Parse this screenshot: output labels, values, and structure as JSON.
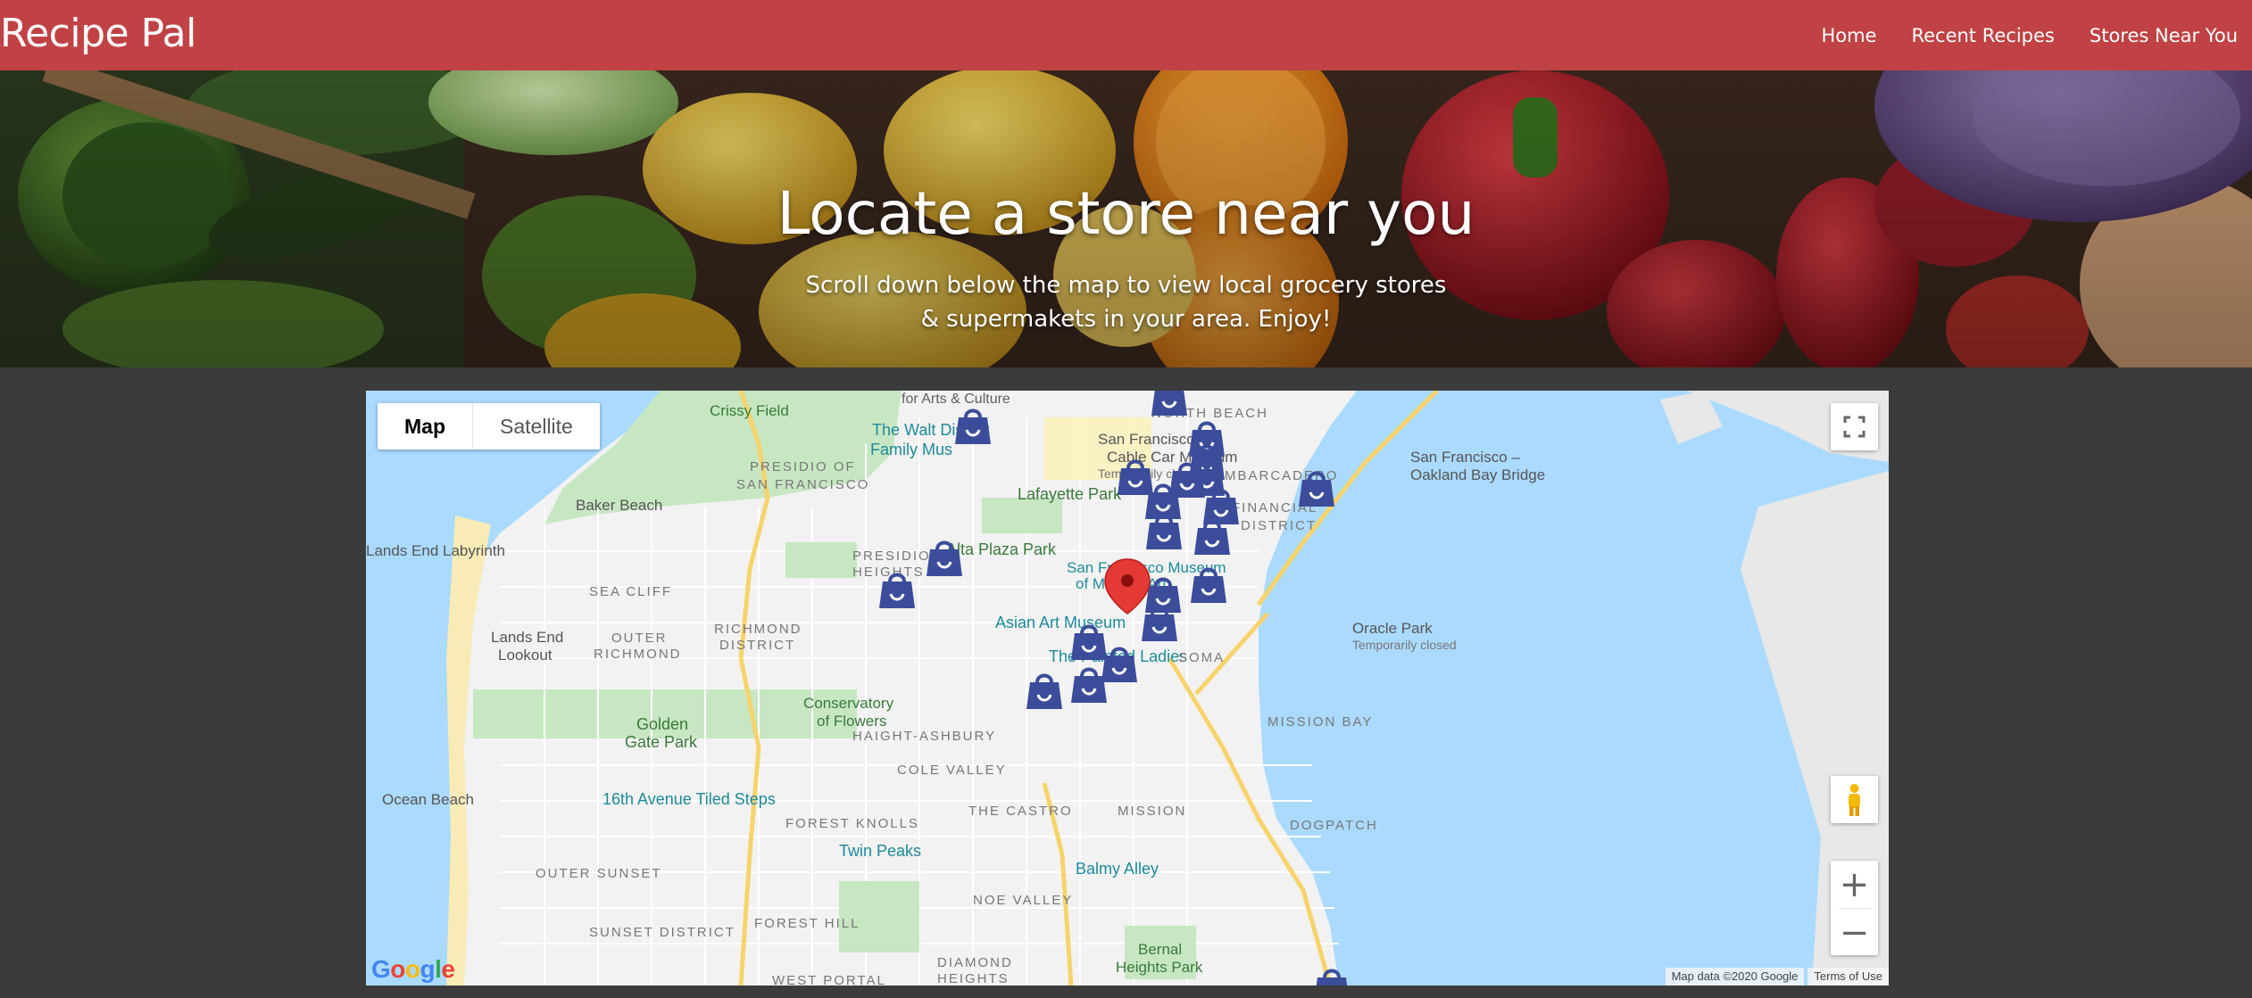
{
  "navbar": {
    "brand": "Recipe Pal",
    "links": [
      "Home",
      "Recent Recipes",
      "Stores Near You"
    ]
  },
  "hero": {
    "title": "Locate a store near you",
    "subtitle_line1": "Scroll down below the map to view local grocery stores",
    "subtitle_line2": "& supermakets in your area. Enjoy!"
  },
  "map": {
    "type_buttons": {
      "map": "Map",
      "satellite": "Satellite"
    },
    "zoom_in": "+",
    "zoom_out": "−",
    "google_logo": "Google",
    "attribution": "Map data ©2020 Google",
    "terms": "Terms of Use",
    "places": [
      "for Arts & Culture",
      "Crissy Field",
      "The Walt Disney",
      "Family Mus",
      "PRESIDIO OF",
      "SAN FRANCISCO",
      "NORTH BEACH",
      "San Francisco",
      "Cable Car Museum",
      "Temporarily closed",
      "EMBARCADERO",
      "San Francisco –",
      "Oakland Bay Bridge",
      "Baker Beach",
      "Lafayette Park",
      "FINANCIAL",
      "DISTRICT",
      "Lands End Labyrinth",
      "Alta Plaza Park",
      "PRESIDIO",
      "HEIGHTS",
      "San Francisco Museum",
      "of Modern Art",
      "SEA CLIFF",
      "Asian Art Museum",
      "Oracle Park",
      "Temporarily closed",
      "Lands End",
      "Lookout",
      "OUTER",
      "RICHMOND",
      "RICHMOND",
      "DISTRICT",
      "The Painted Ladies",
      "SOMA",
      "Conservatory",
      "of Flowers",
      "Golden",
      "Gate Park",
      "HAIGHT-ASHBURY",
      "MISSION BAY",
      "Ocean Beach",
      "COLE VALLEY",
      "16th Avenue Tiled Steps",
      "FOREST KNOLLS",
      "THE CASTRO",
      "MISSION",
      "DOGPATCH",
      "Twin Peaks",
      "Balmy Alley",
      "OUTER SUNSET",
      "NOE VALLEY",
      "SUNSET DISTRICT",
      "FOREST HILL",
      "Bernal",
      "Heights Park",
      "DIAMOND",
      "HEIGHTS",
      "WEST PORTAL"
    ],
    "marker_label": "current-location",
    "store_count": 22
  }
}
